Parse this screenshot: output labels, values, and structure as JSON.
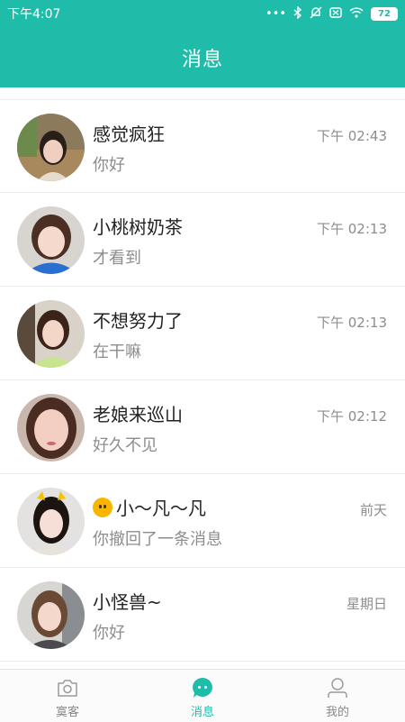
{
  "status_bar": {
    "time": "下午4:07",
    "battery": "72"
  },
  "header": {
    "title": "消息"
  },
  "conversations": [
    {
      "name": "感觉疯狂",
      "preview": "你好",
      "time": "下午 02:43"
    },
    {
      "name": "小桃树奶茶",
      "preview": "才看到",
      "time": "下午 02:13"
    },
    {
      "name": "不想努力了",
      "preview": "在干嘛",
      "time": "下午 02:13"
    },
    {
      "name": "老娘来巡山",
      "preview": "好久不见",
      "time": "下午 02:12"
    },
    {
      "name": "小～凡～凡",
      "preview": "你撤回了一条消息",
      "time": "前天",
      "name_emoji": "chick-emoji"
    },
    {
      "name": "小怪兽~",
      "preview": "你好",
      "time": "星期日"
    }
  ],
  "bottom_nav": [
    {
      "label": "寞客",
      "icon": "camera-icon",
      "active": false
    },
    {
      "label": "消息",
      "icon": "chat-bubble-icon",
      "active": true
    },
    {
      "label": "我的",
      "icon": "person-icon",
      "active": false
    }
  ],
  "colors": {
    "accent": "#1fbcaa",
    "text": "#222222",
    "secondary": "#8d8d8d"
  }
}
